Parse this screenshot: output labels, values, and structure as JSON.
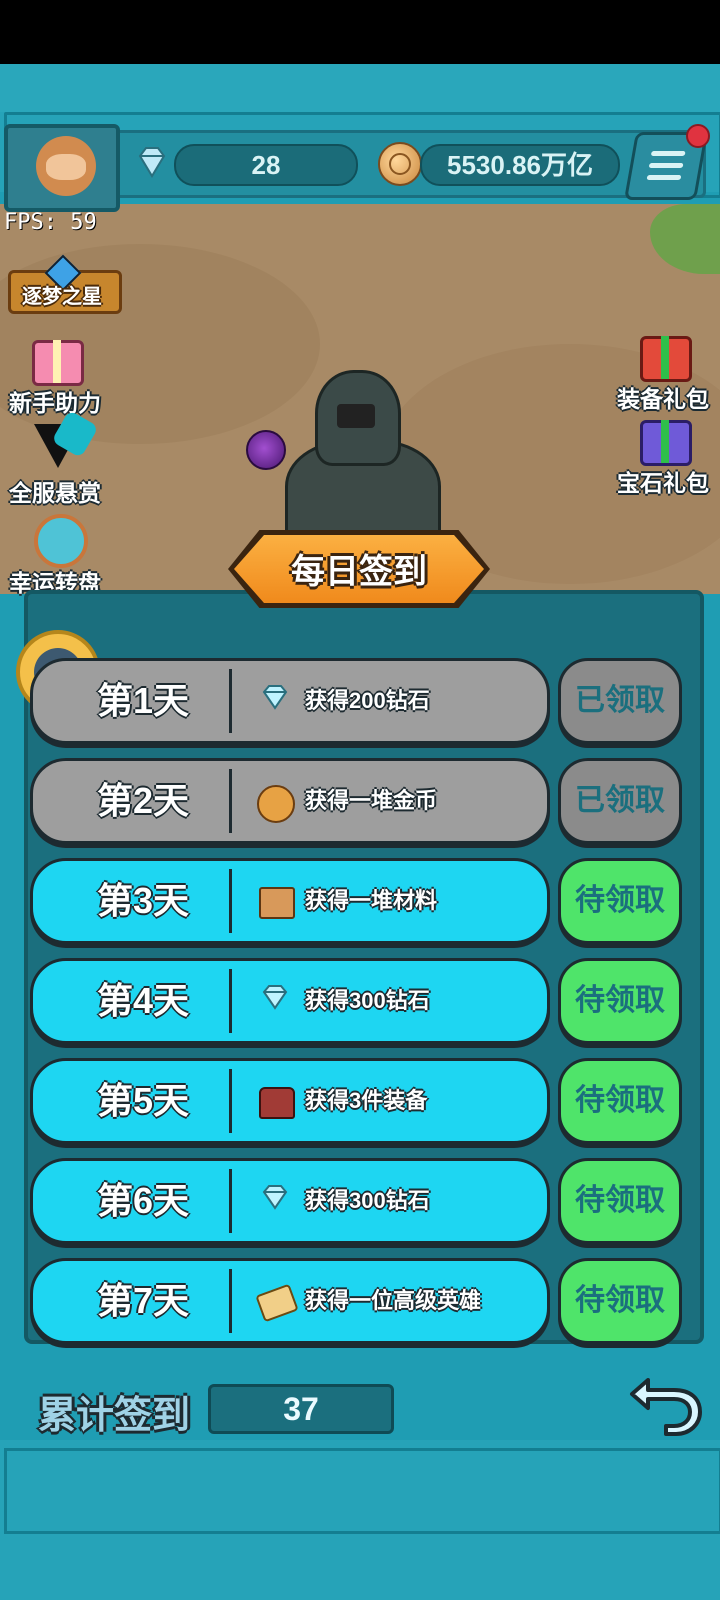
{
  "hud": {
    "fps_text": "FPS: 59",
    "diamonds": "28",
    "gold": "5530.86万亿",
    "star_label": "逐梦之星"
  },
  "left_menu": [
    {
      "label": "新手助力",
      "icon": "gift-icon"
    },
    {
      "label": "全服悬赏",
      "icon": "bounty-icon"
    },
    {
      "label": "幸运转盘",
      "icon": "wheel-icon"
    }
  ],
  "right_menu": [
    {
      "label": "装备礼包",
      "icon": "gift-icon"
    },
    {
      "label": "宝石礼包",
      "icon": "gift-icon"
    }
  ],
  "title": "每日签到",
  "days": [
    {
      "day": "第1天",
      "reward": "获得200钻石",
      "icon": "diamond-icon",
      "status": "已领取",
      "claimed": true
    },
    {
      "day": "第2天",
      "reward": "获得一堆金币",
      "icon": "coins-icon",
      "status": "已领取",
      "claimed": true
    },
    {
      "day": "第3天",
      "reward": "获得一堆材料",
      "icon": "box-icon",
      "status": "待领取",
      "claimed": false
    },
    {
      "day": "第4天",
      "reward": "获得300钻石",
      "icon": "diamond-icon",
      "status": "待领取",
      "claimed": false
    },
    {
      "day": "第5天",
      "reward": "获得3件装备",
      "icon": "chest-icon",
      "status": "待领取",
      "claimed": false
    },
    {
      "day": "第6天",
      "reward": "获得300钻石",
      "icon": "diamond-icon",
      "status": "待领取",
      "claimed": false
    },
    {
      "day": "第7天",
      "reward": "获得一位高级英雄",
      "icon": "scroll-icon",
      "status": "待领取",
      "claimed": false
    }
  ],
  "cumulative": {
    "label": "累计签到",
    "value": "37"
  },
  "colors": {
    "claimed_row": "#9e9e9e",
    "pending_row": "#1ed6f2",
    "pending_button": "#4fe46a",
    "claimed_button": "#8b8b8b",
    "panel": "#1b6f7e",
    "banner": "#f08a1c"
  }
}
